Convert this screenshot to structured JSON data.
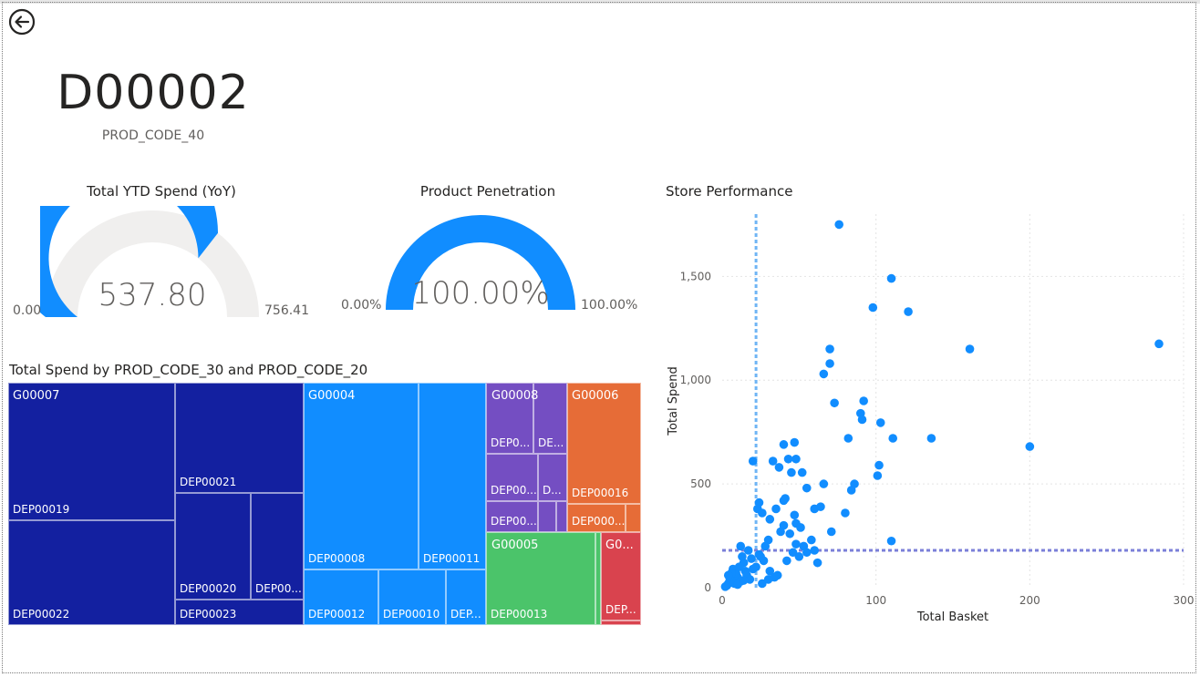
{
  "card": {
    "value": "D00002",
    "subtitle": "PROD_CODE_40"
  },
  "gauges": [
    {
      "title": "Total YTD Spend (YoY)",
      "value_text": "537.80",
      "min_text": "0.00",
      "max_text": "756.41",
      "value": 537.8,
      "max": 756.41
    },
    {
      "title": "Product Penetration",
      "value_text": "100.00%",
      "min_text": "0.00%",
      "max_text": "100.00%",
      "value": 100,
      "max": 100
    }
  ],
  "treemap": {
    "title": "Total Spend by PROD_CODE_30 and PROD_CODE_20",
    "groups": [
      "G00007",
      "G00004",
      "G00008",
      "G00006",
      "G00005",
      "G0..."
    ],
    "tiles": [
      "DEP00019",
      "DEP00022",
      "DEP00021",
      "DEP00020",
      "DEP00...",
      "DEP00023",
      "DEP00008",
      "DEP00011",
      "DEP00012",
      "DEP00010",
      "DEP...",
      "DEP0...",
      "DE...",
      "DEP00...",
      "D...",
      "DEP00...",
      "DEP00016",
      "DEP000...",
      "DEP00013",
      "DEP..."
    ],
    "colors": {
      "navy": "#1320A0",
      "blue": "#118DFF",
      "purple": "#744EC2",
      "orange": "#E66C37",
      "green": "#4BC46A",
      "red": "#D9434E"
    }
  },
  "chart_data": {
    "type": "scatter",
    "title": "Store Performance",
    "xlabel": "Total Basket",
    "ylabel": "Total Spend",
    "xlim": [
      0,
      300
    ],
    "ylim": [
      0,
      1800
    ],
    "xticks": [
      "0",
      "100",
      "200",
      "300"
    ],
    "yticks": [
      "0",
      "500",
      "1,000",
      "1,500"
    ],
    "avg_x": 22,
    "avg_y": 180,
    "point_color": "#118DFF",
    "points": [
      [
        76,
        1750
      ],
      [
        110,
        1490
      ],
      [
        98,
        1350
      ],
      [
        121,
        1330
      ],
      [
        161,
        1150
      ],
      [
        284,
        1175
      ],
      [
        70,
        1150
      ],
      [
        66,
        1030
      ],
      [
        70,
        1080
      ],
      [
        73,
        890
      ],
      [
        92,
        900
      ],
      [
        90,
        840
      ],
      [
        91,
        810
      ],
      [
        103,
        795
      ],
      [
        82,
        720
      ],
      [
        111,
        720
      ],
      [
        136,
        720
      ],
      [
        200,
        680
      ],
      [
        102,
        590
      ],
      [
        101,
        540
      ],
      [
        86,
        500
      ],
      [
        84,
        470
      ],
      [
        66,
        500
      ],
      [
        80,
        360
      ],
      [
        71,
        270
      ],
      [
        110,
        225
      ],
      [
        40,
        690
      ],
      [
        47,
        700
      ],
      [
        43,
        620
      ],
      [
        48,
        620
      ],
      [
        52,
        555
      ],
      [
        45,
        555
      ],
      [
        37,
        580
      ],
      [
        33,
        610
      ],
      [
        20,
        610
      ],
      [
        23,
        380
      ],
      [
        24,
        410
      ],
      [
        26,
        360
      ],
      [
        31,
        330
      ],
      [
        35,
        380
      ],
      [
        40,
        420
      ],
      [
        41,
        430
      ],
      [
        47,
        350
      ],
      [
        48,
        310
      ],
      [
        51,
        290
      ],
      [
        55,
        480
      ],
      [
        60,
        380
      ],
      [
        64,
        390
      ],
      [
        58,
        230
      ],
      [
        53,
        200
      ],
      [
        48,
        210
      ],
      [
        44,
        260
      ],
      [
        40,
        300
      ],
      [
        38,
        270
      ],
      [
        30,
        230
      ],
      [
        28,
        200
      ],
      [
        25,
        150
      ],
      [
        22,
        100
      ],
      [
        19,
        140
      ],
      [
        17,
        180
      ],
      [
        14,
        120
      ],
      [
        12,
        200
      ],
      [
        15,
        80
      ],
      [
        10,
        50
      ],
      [
        8,
        60
      ],
      [
        6,
        30
      ],
      [
        5,
        40
      ],
      [
        4,
        20
      ],
      [
        3,
        10
      ],
      [
        2,
        5
      ],
      [
        7,
        90
      ],
      [
        9,
        70
      ],
      [
        11,
        100
      ],
      [
        13,
        150
      ],
      [
        16,
        60
      ],
      [
        18,
        40
      ],
      [
        20,
        90
      ],
      [
        24,
        160
      ],
      [
        27,
        130
      ],
      [
        31,
        80
      ],
      [
        34,
        50
      ],
      [
        36,
        60
      ],
      [
        42,
        130
      ],
      [
        46,
        170
      ],
      [
        50,
        150
      ],
      [
        55,
        170
      ],
      [
        60,
        180
      ],
      [
        62,
        120
      ],
      [
        26,
        20
      ],
      [
        30,
        40
      ],
      [
        12,
        30
      ],
      [
        6,
        70
      ],
      [
        4,
        60
      ],
      [
        8,
        20
      ],
      [
        10,
        15
      ],
      [
        14,
        35
      ]
    ]
  }
}
